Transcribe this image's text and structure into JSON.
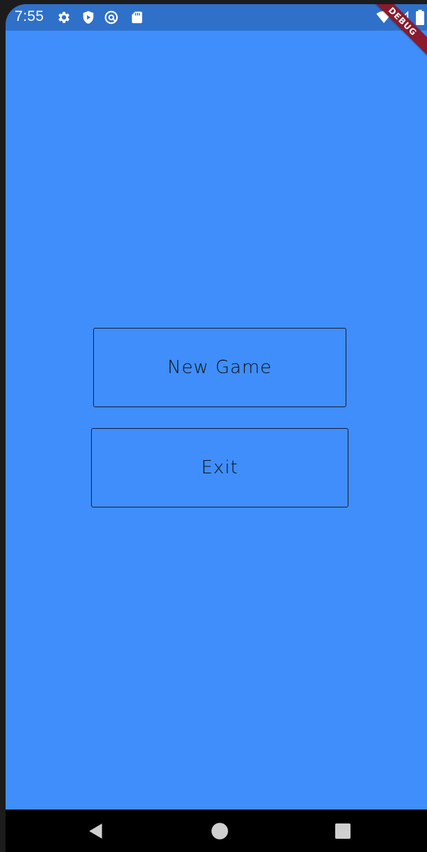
{
  "status_bar": {
    "time": "7:55",
    "icons": [
      "gear-icon",
      "shield-play-icon",
      "at-sync-icon",
      "sdcard-icon",
      "wifi-icon",
      "signal-icon",
      "battery-icon"
    ]
  },
  "debug_banner": {
    "label": "DEBUG"
  },
  "menu": {
    "new_game_label": "New Game",
    "exit_label": "Exit"
  },
  "nav_bar": {
    "icons": [
      "back-icon",
      "home-icon",
      "recents-icon"
    ]
  },
  "colors": {
    "background": "#3f8efc",
    "status_bar": "#2f70c9",
    "banner": "#8b1a2b",
    "button_border": "#1a1a2e"
  }
}
